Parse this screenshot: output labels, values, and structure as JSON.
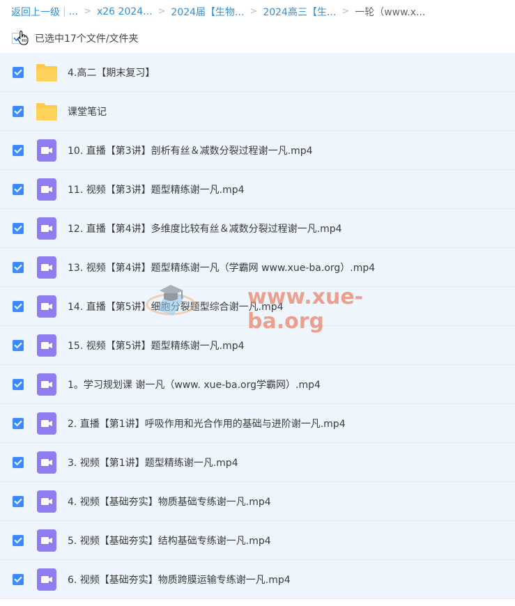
{
  "breadcrumb": {
    "back": "返回上一级",
    "ellipsis": "...",
    "items": [
      "x26 2024...",
      "2024届【生物...",
      "2024高三【生...",
      "一轮（www.x..."
    ]
  },
  "selection": {
    "label": "已选中17个文件/文件夹"
  },
  "files": [
    {
      "type": "folder",
      "name": "4.高二【期末复习】"
    },
    {
      "type": "folder",
      "name": "课堂笔记"
    },
    {
      "type": "video",
      "name": "10. 直播【第3讲】剖析有丝＆减数分裂过程谢一凡.mp4"
    },
    {
      "type": "video",
      "name": "11. 视频【第3讲】题型精练谢一凡.mp4"
    },
    {
      "type": "video",
      "name": "12. 直播【第4讲】多维度比较有丝＆减数分裂过程谢一凡.mp4"
    },
    {
      "type": "video",
      "name": "13. 视频【第4讲】题型精练谢一凡（学霸网 www.xue-ba.org）.mp4"
    },
    {
      "type": "video",
      "name": "14. 直播【第5讲】细胞分裂题型综合谢一凡.mp4"
    },
    {
      "type": "video",
      "name": "15. 视频【第5讲】题型精练谢一凡.mp4"
    },
    {
      "type": "video",
      "name": "1。学习规划课 谢一凡（www. xue-ba.org学霸网）.mp4"
    },
    {
      "type": "video",
      "name": "2. 直播【第1讲】呼吸作用和光合作用的基础与进阶谢一凡.mp4"
    },
    {
      "type": "video",
      "name": "3. 视频【第1讲】题型精练谢一凡.mp4"
    },
    {
      "type": "video",
      "name": "4. 视频【基础夯实】物质基础专练谢一凡.mp4"
    },
    {
      "type": "video",
      "name": "5. 视频【基础夯实】结构基础专练谢一凡.mp4"
    },
    {
      "type": "video",
      "name": "6. 视频【基础夯实】物质跨膜运输专练谢一凡.mp4"
    }
  ],
  "watermark": {
    "text": "www.xue-ba.org"
  },
  "colors": {
    "link": "#2e8fdc",
    "checkbox": "#3b8cff",
    "row_bg": "#eef5fd",
    "folder": "#ffc94d",
    "video": "#8f7cf0"
  }
}
